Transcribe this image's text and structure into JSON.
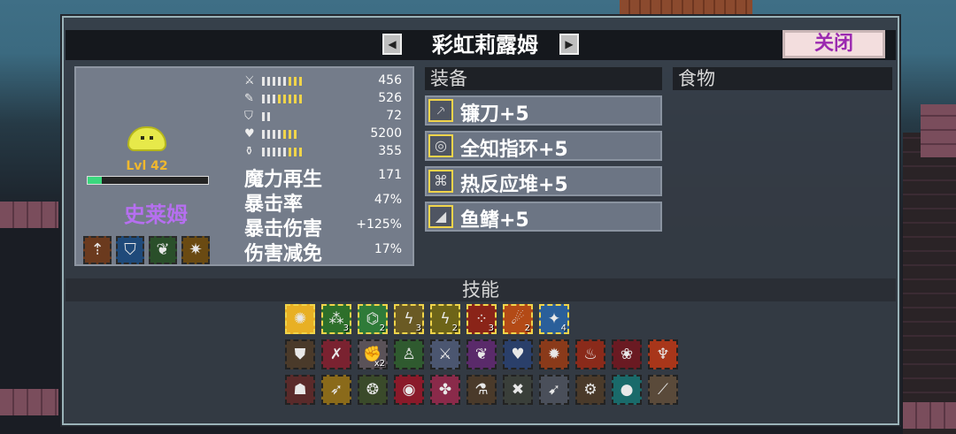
{
  "title": "彩虹莉露姆",
  "close_label": "关闭",
  "nav": {
    "prev_glyph": "◀",
    "next_glyph": "▶"
  },
  "character": {
    "level": "Lvl 42",
    "level_progress": 0.12,
    "name": "史莱姆",
    "badge_icons": [
      "axe-up-icon",
      "shield-drop-icon",
      "leaf-shield-icon",
      "sun-icon"
    ]
  },
  "stats": [
    {
      "icon": "sword-icon",
      "glyph": "⚔",
      "white": 8,
      "gold": 3,
      "value": "456"
    },
    {
      "icon": "spell-icon",
      "glyph": "✎",
      "white": 8,
      "gold": 5,
      "value": "526"
    },
    {
      "icon": "shield-icon",
      "glyph": "⛉",
      "white": 2,
      "gold": 0,
      "value": "72"
    },
    {
      "icon": "heart-icon",
      "glyph": "♥",
      "white": 7,
      "gold": 3,
      "value": "5200"
    },
    {
      "icon": "potion-icon",
      "glyph": "⚱",
      "white": 8,
      "gold": 3,
      "value": "355"
    }
  ],
  "big_stats": [
    {
      "label": "魔力再生",
      "value": "171"
    },
    {
      "label": "暴击率",
      "value": "47%"
    },
    {
      "label": "暴击伤害",
      "value": "+125%"
    },
    {
      "label": "伤害减免",
      "value": "17%"
    }
  ],
  "sections": {
    "equipment": "装备",
    "food": "食物",
    "skills": "技能"
  },
  "equipment": [
    {
      "name": "镰刀+5",
      "icon": "sickle-icon",
      "glyph": "⸕"
    },
    {
      "name": "全知指环+5",
      "icon": "ring-icon",
      "glyph": "◎"
    },
    {
      "name": "热反应堆+5",
      "icon": "reactor-icon",
      "glyph": "⌘"
    },
    {
      "name": "鱼鳍+5",
      "icon": "fin-icon",
      "glyph": "◢"
    }
  ],
  "skills_row1": [
    {
      "icon": "rainbow-burst-icon",
      "glyph": "✺",
      "count": "",
      "color": "#e8b024"
    },
    {
      "icon": "green-dots-icon",
      "glyph": "⁂",
      "count": "3",
      "color": "#2d6f2a"
    },
    {
      "icon": "green-bounce-icon",
      "glyph": "⌬",
      "count": "2",
      "color": "#2f7b39"
    },
    {
      "icon": "lightning-icon",
      "glyph": "ϟ",
      "count": "3",
      "color": "#6a5a24"
    },
    {
      "icon": "lightning-strike-icon",
      "glyph": "ϟ",
      "count": "2",
      "color": "#6d6418"
    },
    {
      "icon": "red-sparks-icon",
      "glyph": "⁘",
      "count": "3",
      "color": "#8a2418"
    },
    {
      "icon": "fireball-icon",
      "glyph": "☄",
      "count": "2",
      "color": "#b34a16"
    },
    {
      "icon": "ice-shard-icon",
      "glyph": "✦",
      "count": "4",
      "color": "#2a5f9a"
    }
  ],
  "skills_row2": [
    {
      "icon": "crest-shield-icon",
      "glyph": "⛊",
      "count": "",
      "color": "#4a3a2a"
    },
    {
      "icon": "red-claw-icon",
      "glyph": "✗",
      "count": "",
      "color": "#7a2230"
    },
    {
      "icon": "fist-icon",
      "glyph": "✊",
      "count": "x2",
      "color": "#5a5258"
    },
    {
      "icon": "green-figure-icon",
      "glyph": "♙",
      "count": "",
      "color": "#2f5a2f"
    },
    {
      "icon": "ghost-blade-icon",
      "glyph": "⚔",
      "count": "",
      "color": "#4b5670"
    },
    {
      "icon": "purple-wings-icon",
      "glyph": "❦",
      "count": "",
      "color": "#5a2a6a"
    },
    {
      "icon": "blue-heart-icon",
      "glyph": "♥",
      "count": "",
      "color": "#2a3f6a"
    },
    {
      "icon": "sun-gear-icon",
      "glyph": "✹",
      "count": "",
      "color": "#8a3a1a"
    },
    {
      "icon": "flame-icon",
      "glyph": "♨",
      "count": "",
      "color": "#8a2a1a"
    },
    {
      "icon": "red-flower-icon",
      "glyph": "❀",
      "count": "",
      "color": "#6a1a22"
    },
    {
      "icon": "phoenix-icon",
      "glyph": "♆",
      "count": "",
      "color": "#a8361a"
    }
  ],
  "skills_row3": [
    {
      "icon": "demon-mask-icon",
      "glyph": "☗",
      "count": "",
      "color": "#5a2a2a"
    },
    {
      "icon": "golden-arrow-icon",
      "glyph": "➶",
      "count": "",
      "color": "#8a6a1a"
    },
    {
      "icon": "wreath-icon",
      "glyph": "❂",
      "count": "",
      "color": "#3a4a2a"
    },
    {
      "icon": "red-eye-icon",
      "glyph": "◉",
      "count": "",
      "color": "#8a1a2a"
    },
    {
      "icon": "pink-paw-icon",
      "glyph": "✤",
      "count": "",
      "color": "#8a2a4a"
    },
    {
      "icon": "bottles-icon",
      "glyph": "⚗",
      "count": "",
      "color": "#4a3a2a"
    },
    {
      "icon": "crossed-blades-icon",
      "glyph": "✖",
      "count": "",
      "color": "#3a3f3a"
    },
    {
      "icon": "rocket-icon",
      "glyph": "➹",
      "count": "",
      "color": "#4a4f5a"
    },
    {
      "icon": "gear-wreath-icon",
      "glyph": "⚙",
      "count": "",
      "color": "#4a3a2a"
    },
    {
      "icon": "red-orb-icon",
      "glyph": "●",
      "count": "",
      "color": "#1a6a6a"
    },
    {
      "icon": "sword-slash-icon",
      "glyph": "⟋",
      "count": "",
      "color": "#5a4a3a"
    }
  ]
}
